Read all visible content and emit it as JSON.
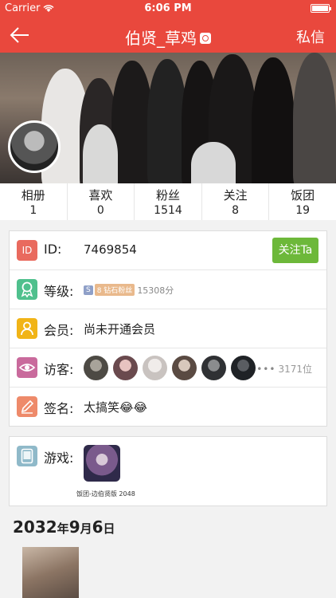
{
  "status_bar": {
    "carrier": "Carrier",
    "time": "6:06 PM"
  },
  "nav": {
    "title": "伯贤_草鸡",
    "right_label": "私信"
  },
  "stats": [
    {
      "label": "相册",
      "value": "1"
    },
    {
      "label": "喜欢",
      "value": "0"
    },
    {
      "label": "粉丝",
      "value": "1514"
    },
    {
      "label": "关注",
      "value": "8"
    },
    {
      "label": "饭团",
      "value": "19"
    }
  ],
  "info": {
    "id_icon": "ID",
    "id_label": "ID:",
    "id_value": "7469854",
    "follow_button": "关注Ta",
    "level_label": "等级:",
    "level_s": "S",
    "level_rank": "8 钻石粉丝",
    "level_points": "15308分",
    "member_label": "会员:",
    "member_value": "尚未开通会员",
    "visitor_label": "访客:",
    "visitor_count": "3171位",
    "signature_label": "签名:",
    "signature_value": "太搞笑😂😂"
  },
  "games": {
    "label": "游戏:",
    "game_name": "饭团-边伯贤版 2048"
  },
  "timeline": {
    "year": "2032",
    "month": "9",
    "day": "6",
    "y_unit": "年",
    "m_unit": "月",
    "d_unit": "日"
  },
  "colors": {
    "brand": "#e9483d",
    "follow": "#6db83a"
  }
}
